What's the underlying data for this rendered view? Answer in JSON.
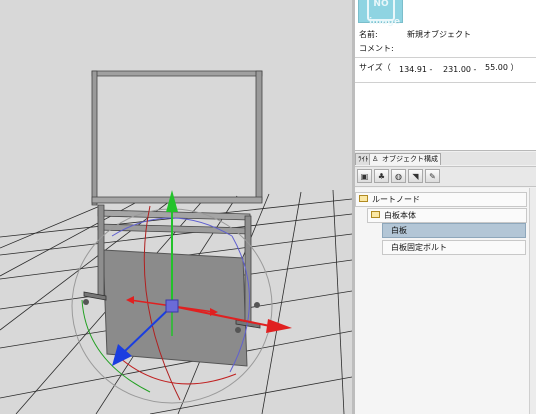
{
  "properties": {
    "thumbnail_text": "NO image",
    "name_label": "名前:",
    "name_value": "新規オブジェクト",
    "comment_label": "コメント:",
    "size_label": "サイズ（",
    "size_x": "134.91 -",
    "size_y": "231.00 -",
    "size_z": "55.00 ）"
  },
  "tabs": {
    "first": "ﾗｲﾄ",
    "second": "オブジェクト構成"
  },
  "toolbar": {
    "icons": [
      "scene-icon",
      "tree-icon",
      "material-icon",
      "light-icon",
      "brush-icon"
    ],
    "glyphs": [
      "▣",
      "♣",
      "◍",
      "◥",
      "✎"
    ]
  },
  "tree": {
    "root": "ルートノード",
    "group": "白板本体",
    "items": [
      "白板",
      "白板固定ボルト"
    ],
    "selected": "白板"
  },
  "colors": {
    "viewport_bg": "#d8d8d8",
    "axis_x": "#e02020",
    "axis_y": "#22c22a",
    "axis_z": "#1a3ee0",
    "selection": "#b3c6d6"
  }
}
